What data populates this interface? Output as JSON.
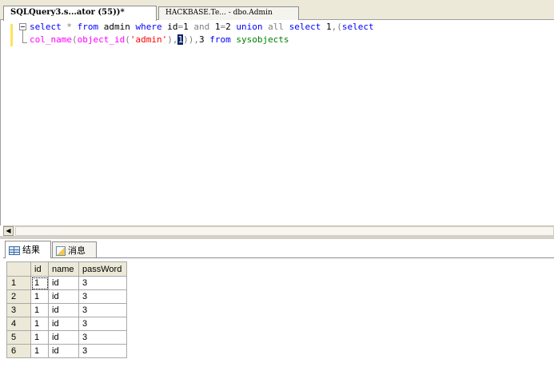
{
  "document_tabs": [
    {
      "label": "SQLQuery3.s...ator (55))*",
      "active": true
    },
    {
      "label": "HACKBASE.Te... - dbo.Admin",
      "active": false
    }
  ],
  "editor": {
    "line1": {
      "select": "select",
      "star": "*",
      "from": "from",
      "table": "admin",
      "where": "where",
      "cond1": "id",
      "eq1": "=",
      "v1": "1",
      "and": "and",
      "v2": "1",
      "eq2": "=",
      "v3": "2",
      "union": "union",
      "all": "all",
      "select2": "select",
      "v4": "1",
      "comma": ",",
      "paren": "(",
      "select3": "select"
    },
    "line2": {
      "col_name": "col_name",
      "open1": "(",
      "object_id": "object_id",
      "open2": "(",
      "arg": "'admin'",
      "close_comma": "),",
      "selected_value": "1",
      "close2": ")),",
      "v3": "3",
      "from": "from",
      "sysobjects": "sysobjects"
    }
  },
  "result_tabs": {
    "results_label": "结果",
    "messages_label": "消息"
  },
  "grid": {
    "columns": [
      "id",
      "name",
      "passWord"
    ],
    "rows": [
      {
        "num": "1",
        "id": "1",
        "name": "id",
        "password": "3"
      },
      {
        "num": "2",
        "id": "1",
        "name": "id",
        "password": "3"
      },
      {
        "num": "3",
        "id": "1",
        "name": "id",
        "password": "3"
      },
      {
        "num": "4",
        "id": "1",
        "name": "id",
        "password": "3"
      },
      {
        "num": "5",
        "id": "1",
        "name": "id",
        "password": "3"
      },
      {
        "num": "6",
        "id": "1",
        "name": "id",
        "password": "3"
      }
    ]
  },
  "colors": {
    "keyword": "#0000ff",
    "string": "#ff0000",
    "function": "#ff00ff",
    "system_object": "#008000",
    "operator": "#808080",
    "chrome": "#ece9d8"
  },
  "icons": {
    "results_tab": "grid-icon",
    "messages_tab": "message-icon",
    "scroll_left": "arrow-left-icon",
    "collapse": "minus-box-icon"
  }
}
